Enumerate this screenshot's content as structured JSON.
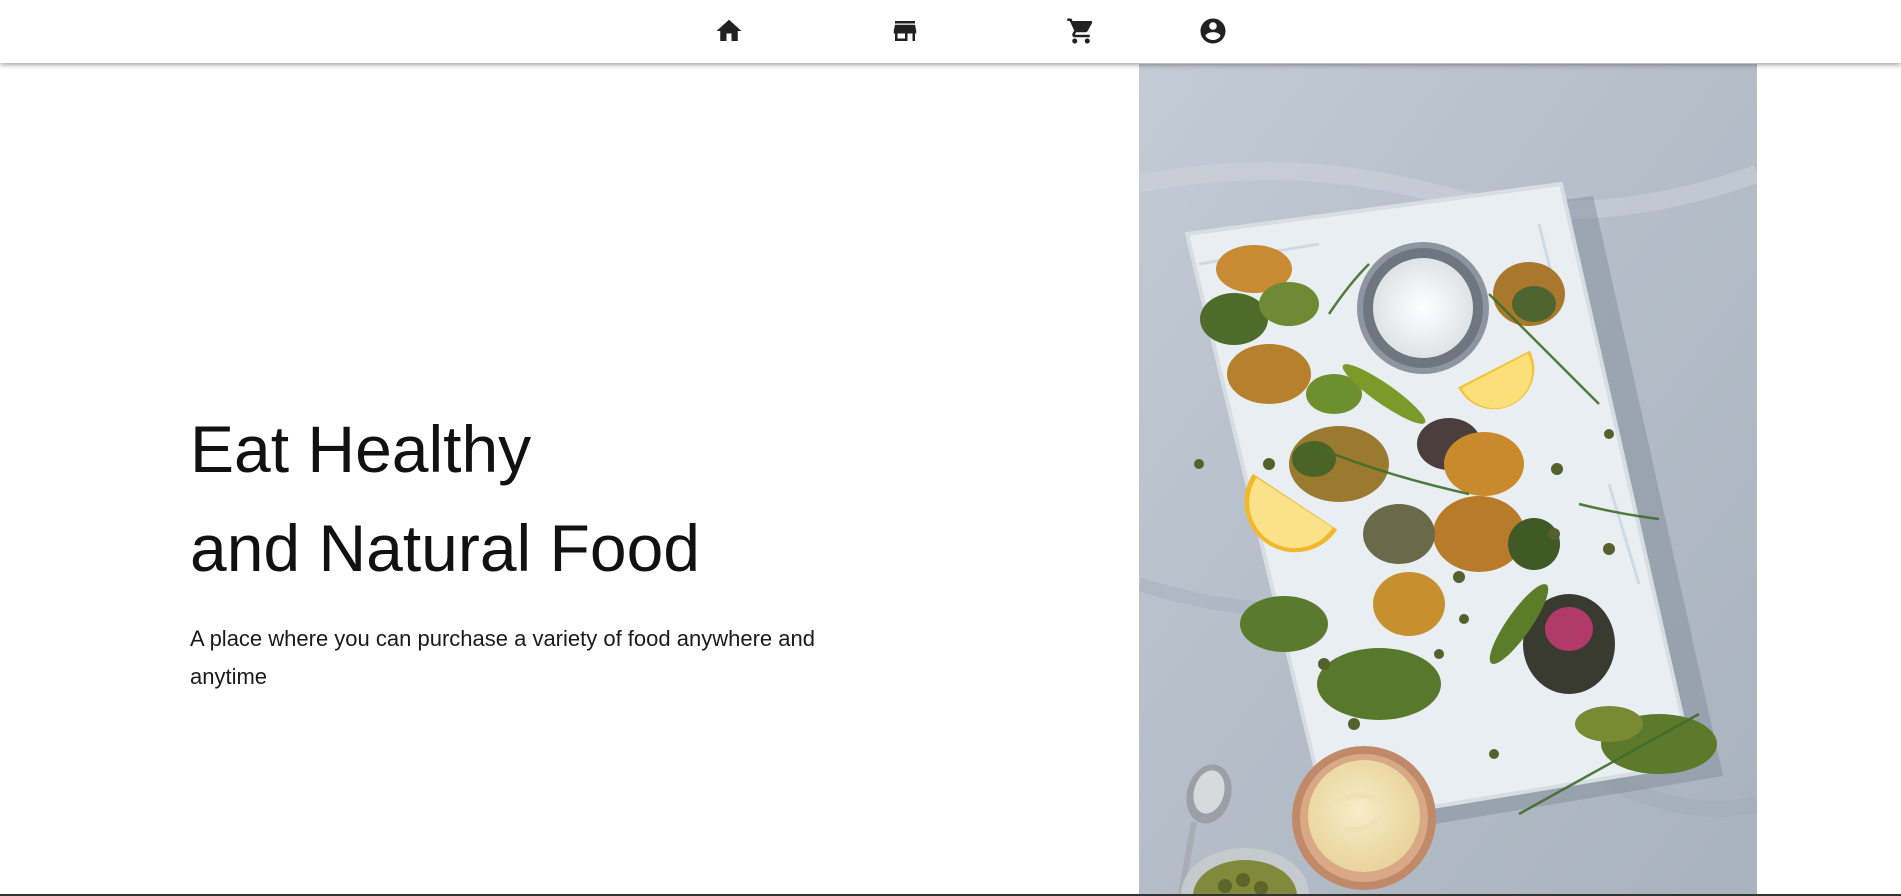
{
  "nav": {
    "items": [
      {
        "name": "home",
        "icon": "home-icon"
      },
      {
        "name": "store",
        "icon": "store-icon"
      },
      {
        "name": "cart",
        "icon": "shopping-cart-icon"
      },
      {
        "name": "account",
        "icon": "account-circle-icon"
      }
    ]
  },
  "hero": {
    "title_line1": "Eat Healthy",
    "title_line2": "and Natural Food",
    "subtitle": "A place where you can purchase a variety of food anywhere and anytime",
    "image": "food-platter-photo"
  },
  "colors": {
    "background": "#ffffff",
    "text": "#111111",
    "icon": "#212121",
    "tablecloth": "#b9c2cc",
    "board": "#e9eef2"
  }
}
